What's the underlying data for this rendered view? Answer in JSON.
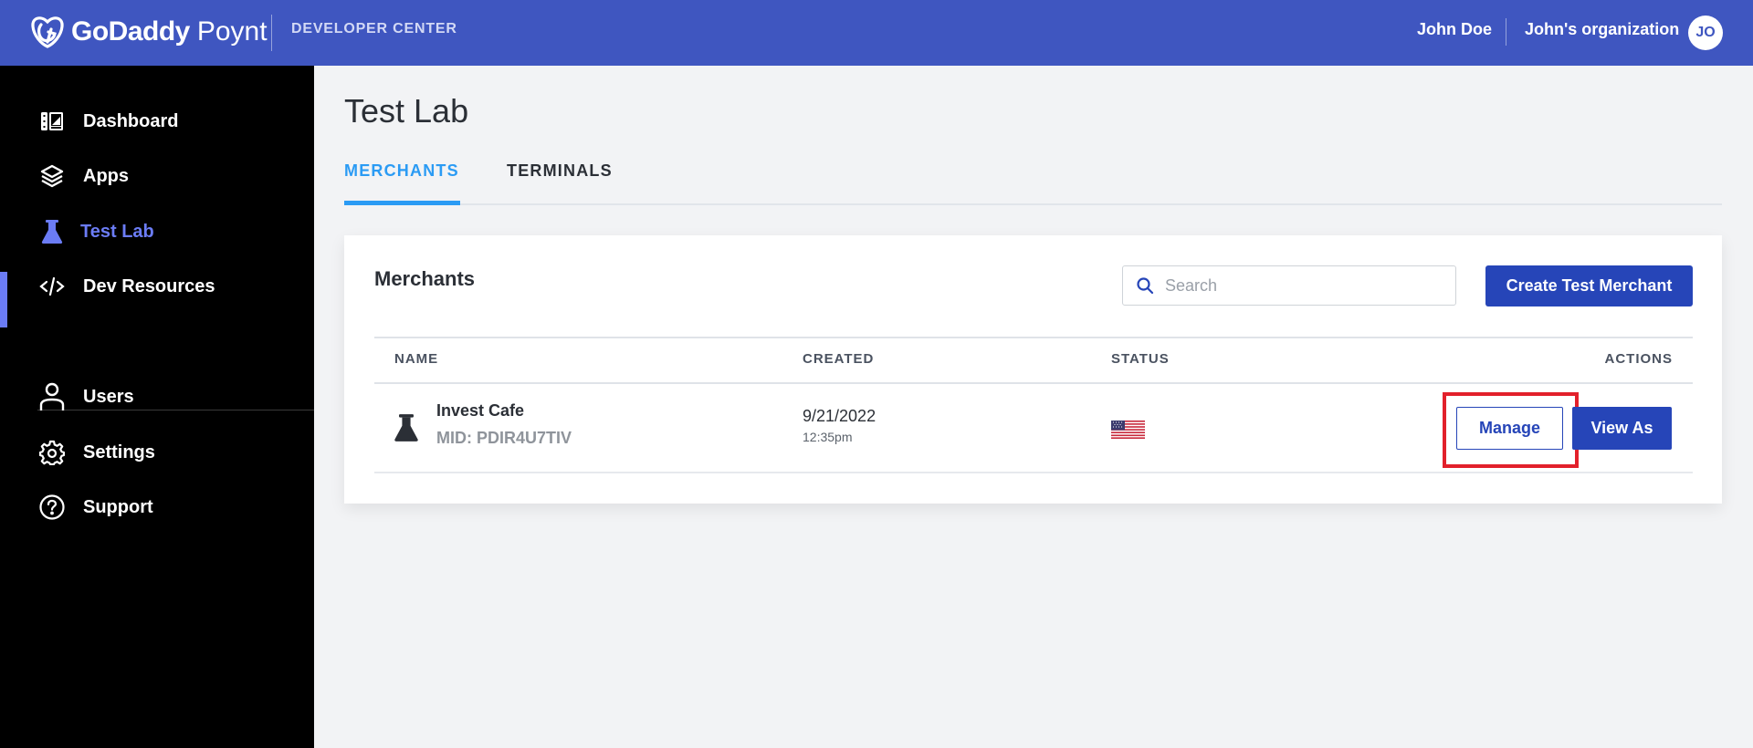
{
  "header": {
    "brand_bold": "GoDaddy",
    "brand_light": "Poynt",
    "section": "DEVELOPER CENTER",
    "user_name": "John Doe",
    "org_name": "John's organization",
    "avatar_initials": "JO",
    "color": "#3f56c0"
  },
  "sidebar": {
    "items": [
      {
        "label": "Dashboard",
        "icon": "dashboard-icon",
        "active": false
      },
      {
        "label": "Apps",
        "icon": "layers-icon",
        "active": false
      },
      {
        "label": "Test Lab",
        "icon": "flask-icon",
        "active": true
      },
      {
        "label": "Dev Resources",
        "icon": "code-icon",
        "active": false
      },
      {
        "label": "Users",
        "icon": "user-icon",
        "active": false
      },
      {
        "label": "Settings",
        "icon": "gear-icon",
        "active": false
      },
      {
        "label": "Support",
        "icon": "help-circle-icon",
        "active": false
      }
    ],
    "active_color": "#6b7cf5"
  },
  "main": {
    "title": "Test Lab",
    "tabs": [
      {
        "label": "MERCHANTS",
        "active": true
      },
      {
        "label": "TERMINALS",
        "active": false
      }
    ],
    "card": {
      "title": "Merchants",
      "search_placeholder": "Search",
      "search_value": "",
      "create_button": "Create Test Merchant",
      "columns": [
        "NAME",
        "CREATED",
        "STATUS",
        "ACTIONS"
      ],
      "rows": [
        {
          "name": "Invest Cafe",
          "mid": "MID: PDIR4U7TIV",
          "created_date": "9/21/2022",
          "created_time": "12:35pm",
          "status_icon": "us-flag-icon",
          "actions": [
            "Manage",
            "View As"
          ]
        }
      ]
    }
  },
  "colors": {
    "primary_button": "#2645b8",
    "tab_active": "#2b9bf4",
    "highlight": "#e2202b"
  }
}
